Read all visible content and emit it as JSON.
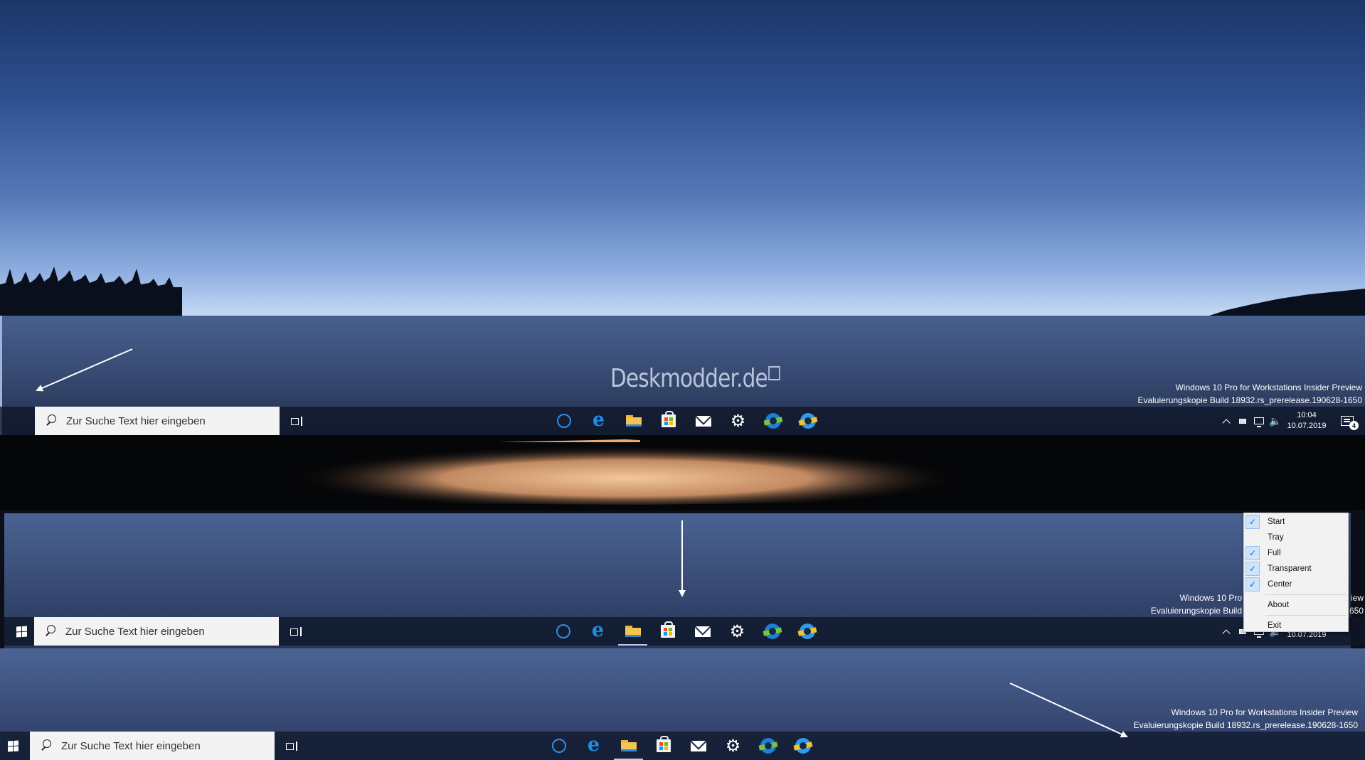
{
  "search_placeholder": "Zur Suche Text hier eingeben",
  "watermark": "Deskmodder.de",
  "edition": {
    "line1": "Windows 10 Pro for Workstations Insider Preview",
    "line2": "Evaluierungskopie Build 18932.rs_prerelease.190628-1650"
  },
  "edition_cropped": {
    "line1": "Windows 10 Pro",
    "line1_tail": "iew",
    "line2": "Evaluierungskopie Build",
    "line2_tail": "650"
  },
  "clock": {
    "time": "10:04",
    "date": "10.07.2019"
  },
  "notification_count": "4",
  "taskbar_apps": [
    "cortana-icon",
    "edge-icon",
    "file-explorer-icon",
    "store-icon",
    "mail-icon",
    "settings-icon",
    "edge-beta-icon",
    "edge-canary-icon"
  ],
  "active_app": "file-explorer",
  "context_menu": {
    "items": [
      {
        "label": "Start",
        "checked": true
      },
      {
        "label": "Tray",
        "checked": false
      },
      {
        "label": "Full",
        "checked": true
      },
      {
        "label": "Transparent",
        "checked": true
      },
      {
        "label": "Center",
        "checked": true
      },
      {
        "label": "About",
        "checked": false
      },
      {
        "label": "Exit",
        "checked": false
      }
    ]
  },
  "colors": {
    "accent": "#2f8ee6",
    "menu_check_bg": "#cde4fb",
    "taskbar": "#0e1628"
  }
}
